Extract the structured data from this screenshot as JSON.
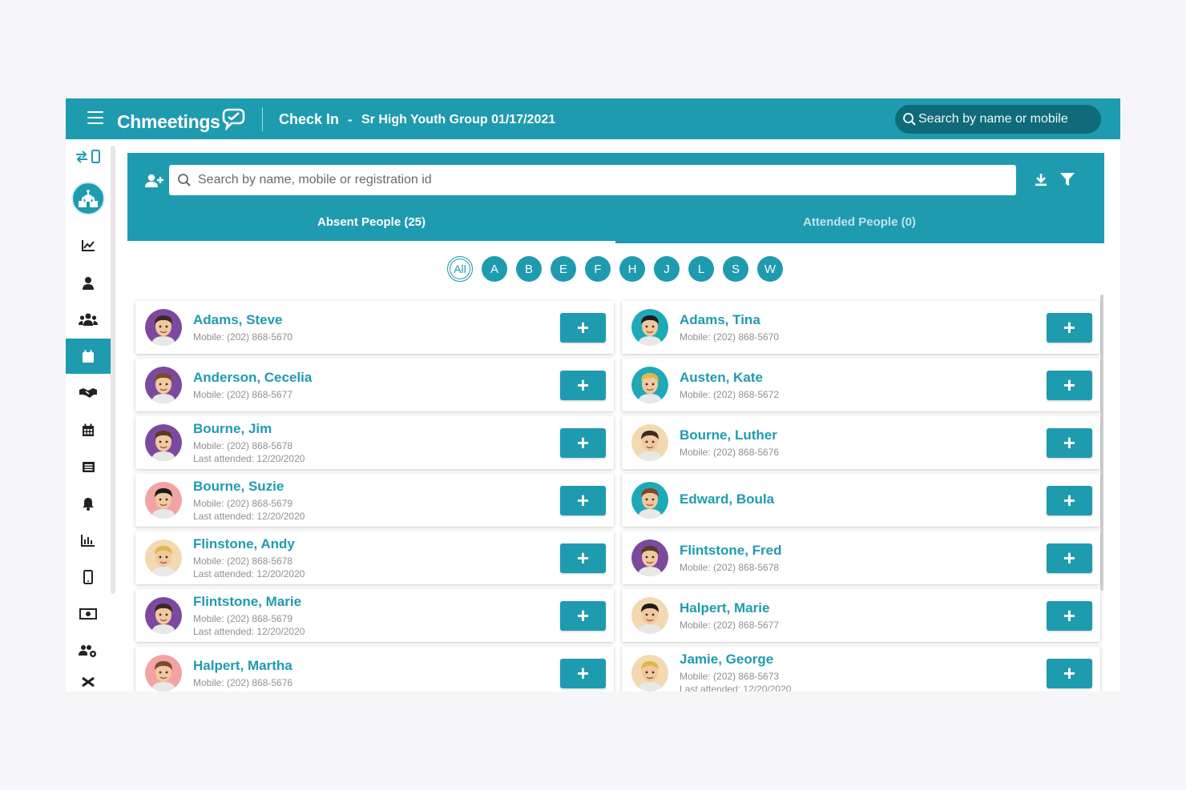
{
  "header": {
    "logo": "Chmeetings",
    "title": "Check In",
    "separator": "-",
    "subtitle": "Sr High Youth Group 01/17/2021",
    "search_placeholder": "Search by name or mobile"
  },
  "sidebar": {
    "items": [
      {
        "icon": "switch-device-icon"
      },
      {
        "icon": "church-logo-icon"
      },
      {
        "icon": "dashboard-chart-icon"
      },
      {
        "icon": "person-icon"
      },
      {
        "icon": "people-group-icon"
      },
      {
        "icon": "check-in-icon",
        "active": true
      },
      {
        "icon": "handshake-icon"
      },
      {
        "icon": "calendar-icon"
      },
      {
        "icon": "list-icon"
      },
      {
        "icon": "bell-icon"
      },
      {
        "icon": "bar-chart-icon"
      },
      {
        "icon": "mobile-icon"
      },
      {
        "icon": "money-icon"
      },
      {
        "icon": "users-settings-icon"
      },
      {
        "icon": "tools-icon"
      }
    ]
  },
  "main": {
    "search_placeholder": "Search by name, mobile or registration id",
    "tabs": [
      {
        "label": "Absent People (25)",
        "active": true
      },
      {
        "label": "Attended People (0)",
        "active": false
      }
    ],
    "letters": [
      "All",
      "A",
      "B",
      "E",
      "F",
      "H",
      "J",
      "L",
      "S",
      "W"
    ],
    "add_label": "+"
  },
  "people": [
    {
      "name": "Adams, Steve",
      "mobile": "Mobile: (202) 868-5670",
      "last": "",
      "color": "#7b4a9e"
    },
    {
      "name": "Adams, Tina",
      "mobile": "Mobile: (202) 868-5670",
      "last": "",
      "color": "#1fa9b8"
    },
    {
      "name": "Anderson, Cecelia",
      "mobile": "Mobile: (202) 868-5677",
      "last": "",
      "color": "#7b4a9e"
    },
    {
      "name": "Austen, Kate",
      "mobile": "Mobile: (202) 868-5672",
      "last": "",
      "color": "#1fa9b8"
    },
    {
      "name": "Bourne, Jim",
      "mobile": "Mobile: (202) 868-5678",
      "last": "Last attended: 12/20/2020",
      "color": "#7b4a9e"
    },
    {
      "name": "Bourne, Luther",
      "mobile": "Mobile: (202) 868-5676",
      "last": "",
      "color": "#f3d9b1"
    },
    {
      "name": "Bourne, Suzie",
      "mobile": "Mobile: (202) 868-5679",
      "last": "Last attended: 12/20/2020",
      "color": "#f2a3a3"
    },
    {
      "name": "Edward, Boula",
      "mobile": "",
      "last": "",
      "color": "#1fa9b8"
    },
    {
      "name": "Flinstone, Andy",
      "mobile": "Mobile: (202) 868-5678",
      "last": "Last attended: 12/20/2020",
      "color": "#f3d9b1"
    },
    {
      "name": "Flintstone, Fred",
      "mobile": "Mobile: (202) 868-5678",
      "last": "",
      "color": "#7b4a9e"
    },
    {
      "name": "Flintstone, Marie",
      "mobile": "Mobile: (202) 868-5679",
      "last": "Last attended: 12/20/2020",
      "color": "#7b4a9e"
    },
    {
      "name": "Halpert, Marie",
      "mobile": "Mobile: (202) 868-5677",
      "last": "",
      "color": "#f3d9b1"
    },
    {
      "name": "Halpert, Martha",
      "mobile": "Mobile: (202) 868-5676",
      "last": "",
      "color": "#f2a3a3"
    },
    {
      "name": "Jamie, George",
      "mobile": "Mobile: (202) 868-5673",
      "last": "Last attended: 12/20/2020",
      "color": "#f3d9b1"
    }
  ]
}
